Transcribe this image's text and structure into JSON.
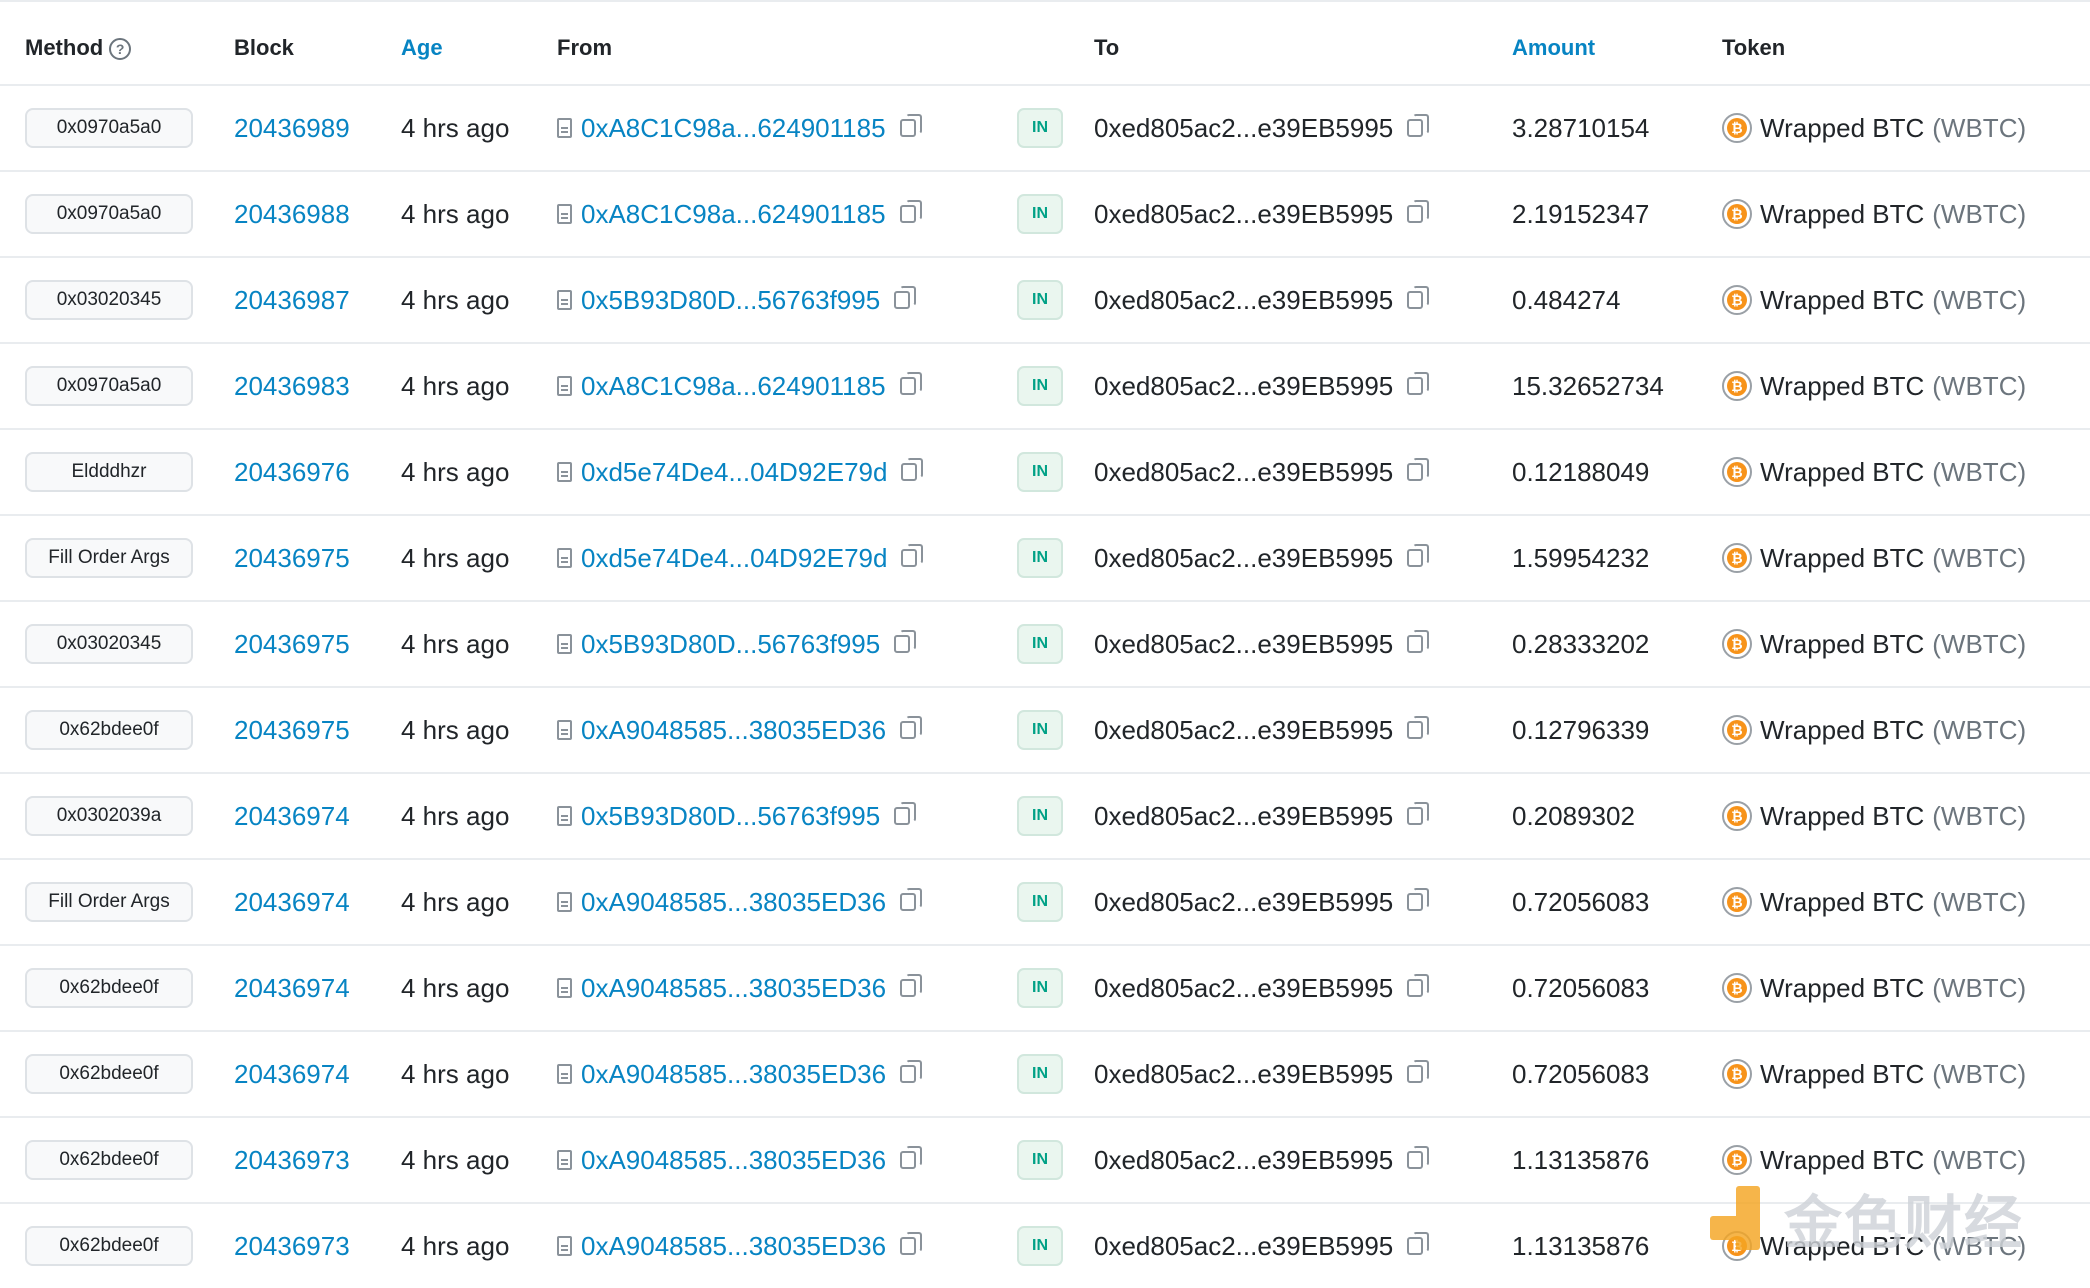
{
  "headers": {
    "method": "Method",
    "block": "Block",
    "age": "Age",
    "from": "From",
    "to": "To",
    "amount": "Amount",
    "token": "Token"
  },
  "colors": {
    "link": "#0784c3",
    "in_badge": "#00a186",
    "coin": "#f7931a"
  },
  "rows": [
    {
      "method": "0x0970a5a0",
      "block": "20436989",
      "age": "4 hrs ago",
      "from": "0xA8C1C98a...624901185",
      "direction": "IN",
      "to": "0xed805ac2...e39EB5995",
      "amount": "3.28710154",
      "token_name": "Wrapped BTC",
      "token_symbol": "(WBTC)"
    },
    {
      "method": "0x0970a5a0",
      "block": "20436988",
      "age": "4 hrs ago",
      "from": "0xA8C1C98a...624901185",
      "direction": "IN",
      "to": "0xed805ac2...e39EB5995",
      "amount": "2.19152347",
      "token_name": "Wrapped BTC",
      "token_symbol": "(WBTC)"
    },
    {
      "method": "0x03020345",
      "block": "20436987",
      "age": "4 hrs ago",
      "from": "0x5B93D80D...56763f995",
      "direction": "IN",
      "to": "0xed805ac2...e39EB5995",
      "amount": "0.484274",
      "token_name": "Wrapped BTC",
      "token_symbol": "(WBTC)"
    },
    {
      "method": "0x0970a5a0",
      "block": "20436983",
      "age": "4 hrs ago",
      "from": "0xA8C1C98a...624901185",
      "direction": "IN",
      "to": "0xed805ac2...e39EB5995",
      "amount": "15.32652734",
      "token_name": "Wrapped BTC",
      "token_symbol": "(WBTC)"
    },
    {
      "method": "Eldddhzr",
      "block": "20436976",
      "age": "4 hrs ago",
      "from": "0xd5e74De4...04D92E79d",
      "direction": "IN",
      "to": "0xed805ac2...e39EB5995",
      "amount": "0.12188049",
      "token_name": "Wrapped BTC",
      "token_symbol": "(WBTC)"
    },
    {
      "method": "Fill Order Args",
      "block": "20436975",
      "age": "4 hrs ago",
      "from": "0xd5e74De4...04D92E79d",
      "direction": "IN",
      "to": "0xed805ac2...e39EB5995",
      "amount": "1.59954232",
      "token_name": "Wrapped BTC",
      "token_symbol": "(WBTC)"
    },
    {
      "method": "0x03020345",
      "block": "20436975",
      "age": "4 hrs ago",
      "from": "0x5B93D80D...56763f995",
      "direction": "IN",
      "to": "0xed805ac2...e39EB5995",
      "amount": "0.28333202",
      "token_name": "Wrapped BTC",
      "token_symbol": "(WBTC)"
    },
    {
      "method": "0x62bdee0f",
      "block": "20436975",
      "age": "4 hrs ago",
      "from": "0xA9048585...38035ED36",
      "direction": "IN",
      "to": "0xed805ac2...e39EB5995",
      "amount": "0.12796339",
      "token_name": "Wrapped BTC",
      "token_symbol": "(WBTC)"
    },
    {
      "method": "0x0302039a",
      "block": "20436974",
      "age": "4 hrs ago",
      "from": "0x5B93D80D...56763f995",
      "direction": "IN",
      "to": "0xed805ac2...e39EB5995",
      "amount": "0.2089302",
      "token_name": "Wrapped BTC",
      "token_symbol": "(WBTC)"
    },
    {
      "method": "Fill Order Args",
      "block": "20436974",
      "age": "4 hrs ago",
      "from": "0xA9048585...38035ED36",
      "direction": "IN",
      "to": "0xed805ac2...e39EB5995",
      "amount": "0.72056083",
      "token_name": "Wrapped BTC",
      "token_symbol": "(WBTC)"
    },
    {
      "method": "0x62bdee0f",
      "block": "20436974",
      "age": "4 hrs ago",
      "from": "0xA9048585...38035ED36",
      "direction": "IN",
      "to": "0xed805ac2...e39EB5995",
      "amount": "0.72056083",
      "token_name": "Wrapped BTC",
      "token_symbol": "(WBTC)"
    },
    {
      "method": "0x62bdee0f",
      "block": "20436974",
      "age": "4 hrs ago",
      "from": "0xA9048585...38035ED36",
      "direction": "IN",
      "to": "0xed805ac2...e39EB5995",
      "amount": "0.72056083",
      "token_name": "Wrapped BTC",
      "token_symbol": "(WBTC)"
    },
    {
      "method": "0x62bdee0f",
      "block": "20436973",
      "age": "4 hrs ago",
      "from": "0xA9048585...38035ED36",
      "direction": "IN",
      "to": "0xed805ac2...e39EB5995",
      "amount": "1.13135876",
      "token_name": "Wrapped BTC",
      "token_symbol": "(WBTC)"
    },
    {
      "method": "0x62bdee0f",
      "block": "20436973",
      "age": "4 hrs ago",
      "from": "0xA9048585...38035ED36",
      "direction": "IN",
      "to": "0xed805ac2...e39EB5995",
      "amount": "1.13135876",
      "token_name": "Wrapped BTC",
      "token_symbol": "(WBTC)"
    }
  ],
  "watermark": {
    "text": "金色财经"
  }
}
